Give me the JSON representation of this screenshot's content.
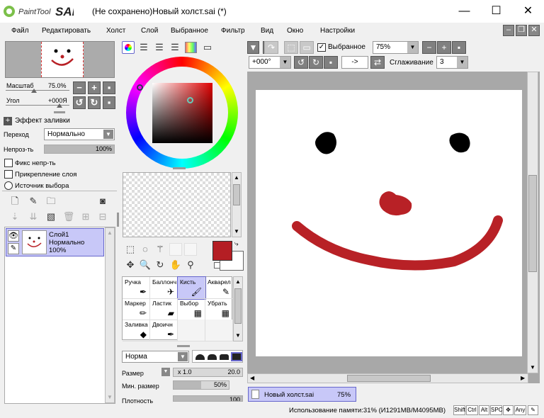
{
  "app": {
    "logo_text": "PaintTool SAI",
    "window_title": "(Не сохранено)Новый холст.sai (*)"
  },
  "window_controls": {
    "minimize": "—",
    "maximize": "☐",
    "close": "✕"
  },
  "menu": [
    "Файл",
    "Редактировать",
    "Холст",
    "Слой",
    "Выбранное",
    "Фильтр",
    "Вид",
    "Окно",
    "Настройки"
  ],
  "navigator": {
    "zoom_label": "Масштаб",
    "zoom_value": "75.0%",
    "angle_label": "Угол",
    "angle_value": "+000Я"
  },
  "layer_props": {
    "fill_effect": "Эффект заливки",
    "blend_label": "Переход",
    "blend_value": "Нормально",
    "opacity_label": "Непроз-ть",
    "opacity_value": "100%",
    "opacity_level": 100,
    "preserve_opacity": "Фикс непр-ть",
    "clipping": "Прикрепление слоя",
    "selection_source": "Источник выбора"
  },
  "layers": [
    {
      "name": "Слой1",
      "mode": "Нормально",
      "opacity": "100%"
    }
  ],
  "toolbar": {
    "selection_label": "Выбранное",
    "selection_checked": true,
    "zoom_value": "75%",
    "rotation_value": "+000°",
    "arrow_button": "->",
    "smoothing_label": "Сглаживание",
    "smoothing_value": "3"
  },
  "tools": [
    {
      "label": "Ручка",
      "icon": "pen-icon",
      "glyph": "✒"
    },
    {
      "label": "Баллонч",
      "icon": "airbrush-icon",
      "glyph": "✈"
    },
    {
      "label": "Кисть",
      "icon": "brush-icon",
      "glyph": "🖌",
      "selected": true
    },
    {
      "label": "Акварел",
      "icon": "watercolor-icon",
      "glyph": "✎"
    },
    {
      "label": "Маркер",
      "icon": "marker-icon",
      "glyph": "✏"
    },
    {
      "label": "Ластик",
      "icon": "eraser-icon",
      "glyph": "▰"
    },
    {
      "label": "Выбор",
      "icon": "select-pen-icon",
      "glyph": "▦"
    },
    {
      "label": "Убрать",
      "icon": "deselect-pen-icon",
      "glyph": "▦"
    },
    {
      "label": "Заливка",
      "icon": "bucket-icon",
      "glyph": "◆"
    },
    {
      "label": "Двоичн",
      "icon": "binary-pen-icon",
      "glyph": "✒"
    }
  ],
  "brush": {
    "mode_value": "Норма",
    "size_label": "Размер",
    "size_multiplier": "x 1.0",
    "size_value": "20.0",
    "min_size_label": "Мин. размер",
    "min_size_value": "50%",
    "min_size_level": 50,
    "density_label": "Плотность",
    "density_value": "100",
    "density_level": 100
  },
  "colors": {
    "primary": "#b41e24",
    "secondary": "#ffffff",
    "accent": "#6666cc",
    "ink": "#b82126"
  },
  "canvas_tab": {
    "name": "Новый холст.sai",
    "zoom": "75%"
  },
  "status": {
    "memory": "Использование памяти:31% (И1291MB/M4095MB)",
    "keys": [
      "Shift",
      "Ctrl",
      "Alt",
      "SPC",
      "✥",
      "Any"
    ]
  }
}
